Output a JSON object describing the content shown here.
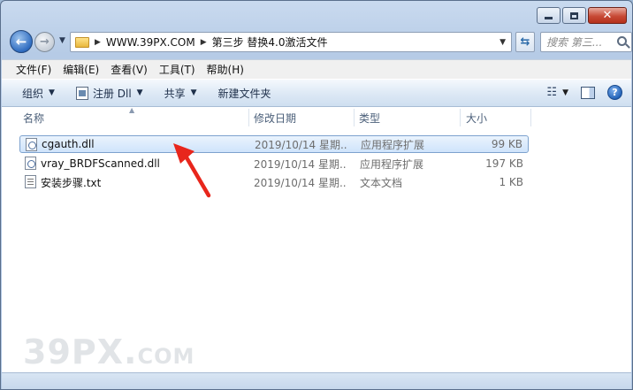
{
  "address": {
    "crumbs": [
      "WWW.39PX.COM",
      "第三步 替换4.0激活文件"
    ]
  },
  "search": {
    "placeholder": "搜索 第三..."
  },
  "menu": [
    "文件(F)",
    "编辑(E)",
    "查看(V)",
    "工具(T)",
    "帮助(H)"
  ],
  "commands": {
    "organize": "组织",
    "register": "注册 Dll",
    "share": "共享",
    "new_folder": "新建文件夹"
  },
  "columns": {
    "name": "名称",
    "date": "修改日期",
    "type": "类型",
    "size": "大小"
  },
  "files": [
    {
      "name": "cgauth.dll",
      "date": "2019/10/14 星期...",
      "type": "应用程序扩展",
      "size": "99 KB",
      "icon": "dll-file-icon",
      "selected": true
    },
    {
      "name": "vray_BRDFScanned.dll",
      "date": "2019/10/14 星期...",
      "type": "应用程序扩展",
      "size": "197 KB",
      "icon": "dll-file-icon",
      "selected": false
    },
    {
      "name": "安装步骤.txt",
      "date": "2019/10/14 星期...",
      "type": "文本文档",
      "size": "1 KB",
      "icon": "text-file-icon",
      "selected": false
    }
  ],
  "watermark": {
    "main": "39PX.",
    "suffix": "COM"
  },
  "colors": {
    "selection": "#cfe4fb",
    "annotation_arrow": "#e8261c"
  }
}
